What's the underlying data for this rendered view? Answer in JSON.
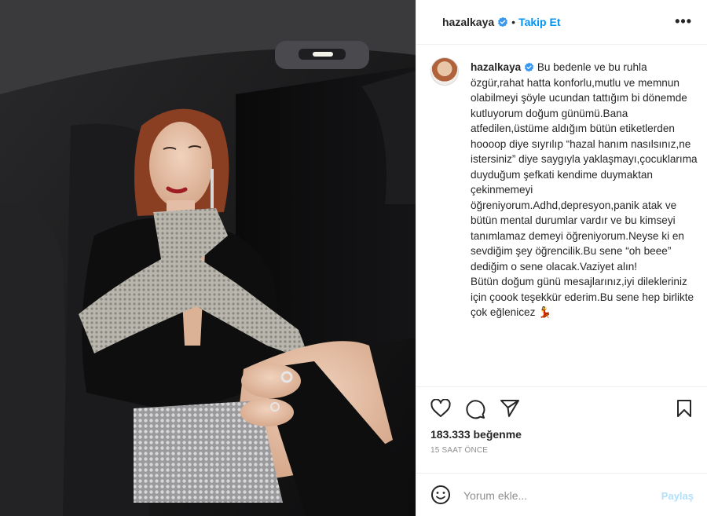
{
  "post": {
    "username": "hazalkaya",
    "separator": "•",
    "follow_label": "Takip Et",
    "more_label": "•••",
    "caption_username": "hazalkaya",
    "caption_text": "Bu bedenle ve bu ruhla özgür,rahat hatta konforlu,mutlu ve memnun olabilmeyi şöyle ucundan tattığım bi dönemde kutluyorum doğum günümü.Bana atfedilen,üstüme aldığım bütün etiketlerden hoooop diye sıyrılıp “hazal hanım nasılsınız,ne istersiniz” diye saygıyla yaklaşmayı,çocuklarıma duyduğum şefkati kendime duymaktan çekinmemeyi öğreniyorum.Adhd,depresyon,panik atak ve bütün mental durumlar vardır ve bu kimseyi tanımlamaz demeyi öğreniyorum.Neyse ki en sevdiğim şey öğrencilik.Bu sene “oh beee” dediğim o sene olacak.Vaziyet alın!\nBütün doğum günü mesajlarınız,iyi dilekleriniz için çoook teşekkür ederim.Bu sene hep birlikte çok eğlenicez 💃",
    "likes": "183.333 beğenme",
    "timestamp": "15 SAAT ÖNCE"
  },
  "comment": {
    "placeholder": "Yorum ekle...",
    "post_label": "Paylaş"
  },
  "icons": {
    "like": "heart-icon",
    "comment": "comment-icon",
    "share": "paper-plane-icon",
    "save": "bookmark-icon",
    "emoji": "smiley-icon",
    "verified": "verified-badge-icon",
    "more": "ellipsis-icon"
  },
  "colors": {
    "accent": "#0095f6",
    "verified": "#3897f0",
    "post_disabled": "#b2dffc",
    "muted": "#8e8e8e",
    "text": "#262626"
  }
}
